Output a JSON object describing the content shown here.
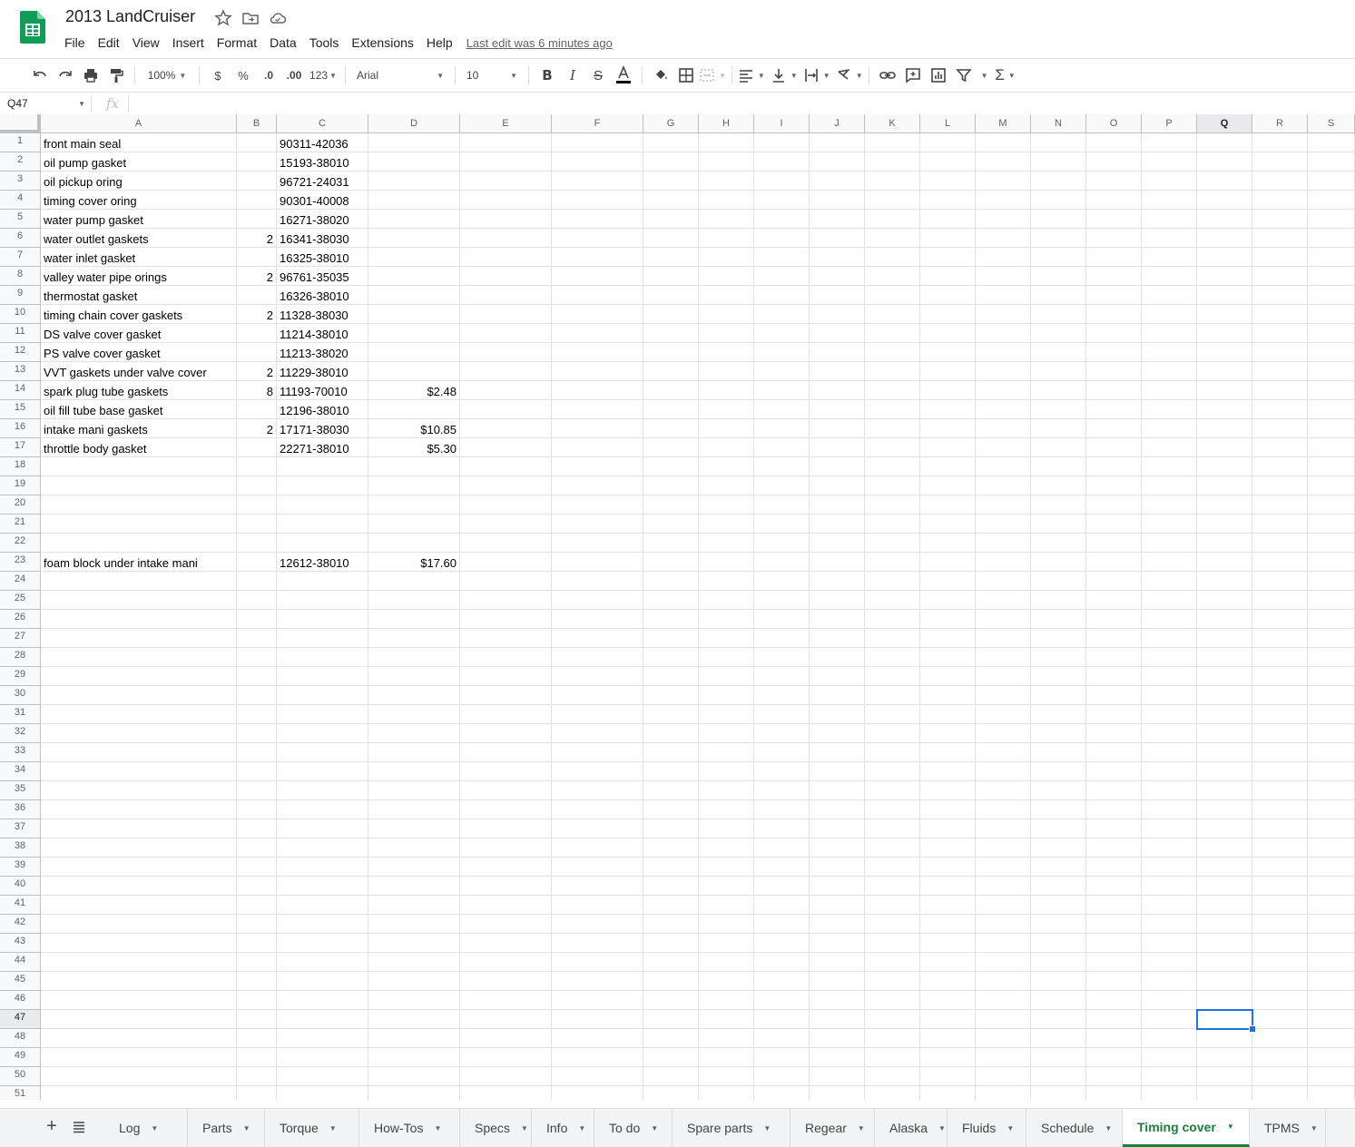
{
  "app": {
    "title": "2013 LandCruiser",
    "menus": [
      "File",
      "Edit",
      "View",
      "Insert",
      "Format",
      "Data",
      "Tools",
      "Extensions",
      "Help"
    ],
    "last_edit": "Last edit was 6 minutes ago"
  },
  "toolbar": {
    "zoom": "100%",
    "currency": "$",
    "percent": "%",
    "dec_decrease": ".0",
    "dec_increase": ".00",
    "more_formats": "123",
    "font": "Arial",
    "font_size": "10"
  },
  "formula_bar": {
    "name_box": "Q47",
    "fx": "fx",
    "value": ""
  },
  "columns": [
    "A",
    "B",
    "C",
    "D",
    "E",
    "F",
    "G",
    "H",
    "I",
    "J",
    "K",
    "L",
    "M",
    "N",
    "O",
    "P",
    "Q",
    "R",
    "S"
  ],
  "selected_cell": "Q47",
  "rows": [
    {
      "n": "1",
      "A": "front main seal",
      "B": "",
      "C": "90311-42036",
      "D": ""
    },
    {
      "n": "2",
      "A": "oil pump gasket",
      "B": "",
      "C": "15193-38010",
      "D": ""
    },
    {
      "n": "3",
      "A": "oil pickup oring",
      "B": "",
      "C": "96721-24031",
      "D": ""
    },
    {
      "n": "4",
      "A": "timing cover oring",
      "B": "",
      "C": "90301-40008",
      "D": ""
    },
    {
      "n": "5",
      "A": "water pump gasket",
      "B": "",
      "C": "16271-38020",
      "D": ""
    },
    {
      "n": "6",
      "A": "water outlet gaskets",
      "B": "2",
      "C": "16341-38030",
      "D": ""
    },
    {
      "n": "7",
      "A": "water inlet gasket",
      "B": "",
      "C": "16325-38010",
      "D": ""
    },
    {
      "n": "8",
      "A": "valley water pipe orings",
      "B": "2",
      "C": "96761-35035",
      "D": ""
    },
    {
      "n": "9",
      "A": "thermostat gasket",
      "B": "",
      "C": "16326-38010",
      "D": ""
    },
    {
      "n": "10",
      "A": "timing chain cover gaskets",
      "B": "2",
      "C": "11328-38030",
      "D": ""
    },
    {
      "n": "11",
      "A": "DS valve cover gasket",
      "B": "",
      "C": "11214-38010",
      "D": ""
    },
    {
      "n": "12",
      "A": "PS valve cover gasket",
      "B": "",
      "C": "11213-38020",
      "D": ""
    },
    {
      "n": "13",
      "A": "VVT gaskets under valve cover",
      "B": "2",
      "C": "11229-38010",
      "D": ""
    },
    {
      "n": "14",
      "A": "spark plug tube gaskets",
      "B": "8",
      "C": "11193-70010",
      "D": "$2.48"
    },
    {
      "n": "15",
      "A": "oil fill tube base gasket",
      "B": "",
      "C": "12196-38010",
      "D": ""
    },
    {
      "n": "16",
      "A": "intake mani gaskets",
      "B": "2",
      "C": "17171-38030",
      "D": "$10.85"
    },
    {
      "n": "17",
      "A": "throttle body gasket",
      "B": "",
      "C": "22271-38010",
      "D": "$5.30"
    },
    {
      "n": "18",
      "A": "",
      "B": "",
      "C": "",
      "D": ""
    },
    {
      "n": "19",
      "A": "",
      "B": "",
      "C": "",
      "D": ""
    },
    {
      "n": "20",
      "A": "",
      "B": "",
      "C": "",
      "D": ""
    },
    {
      "n": "21",
      "A": "",
      "B": "",
      "C": "",
      "D": ""
    },
    {
      "n": "22",
      "A": "",
      "B": "",
      "C": "",
      "D": ""
    },
    {
      "n": "23",
      "A": "foam block under intake mani",
      "B": "",
      "C": "12612-38010",
      "D": "$17.60"
    },
    {
      "n": "24",
      "A": "",
      "B": "",
      "C": "",
      "D": ""
    },
    {
      "n": "25",
      "A": "",
      "B": "",
      "C": "",
      "D": ""
    },
    {
      "n": "26",
      "A": "",
      "B": "",
      "C": "",
      "D": ""
    },
    {
      "n": "27",
      "A": "",
      "B": "",
      "C": "",
      "D": ""
    },
    {
      "n": "28",
      "A": "",
      "B": "",
      "C": "",
      "D": ""
    },
    {
      "n": "29",
      "A": "",
      "B": "",
      "C": "",
      "D": ""
    },
    {
      "n": "30",
      "A": "",
      "B": "",
      "C": "",
      "D": ""
    },
    {
      "n": "31",
      "A": "",
      "B": "",
      "C": "",
      "D": ""
    },
    {
      "n": "32",
      "A": "",
      "B": "",
      "C": "",
      "D": ""
    },
    {
      "n": "33",
      "A": "",
      "B": "",
      "C": "",
      "D": ""
    },
    {
      "n": "34",
      "A": "",
      "B": "",
      "C": "",
      "D": ""
    },
    {
      "n": "35",
      "A": "",
      "B": "",
      "C": "",
      "D": ""
    },
    {
      "n": "36",
      "A": "",
      "B": "",
      "C": "",
      "D": ""
    },
    {
      "n": "37",
      "A": "",
      "B": "",
      "C": "",
      "D": ""
    },
    {
      "n": "38",
      "A": "",
      "B": "",
      "C": "",
      "D": ""
    },
    {
      "n": "39",
      "A": "",
      "B": "",
      "C": "",
      "D": ""
    },
    {
      "n": "40",
      "A": "",
      "B": "",
      "C": "",
      "D": ""
    },
    {
      "n": "41",
      "A": "",
      "B": "",
      "C": "",
      "D": ""
    },
    {
      "n": "42",
      "A": "",
      "B": "",
      "C": "",
      "D": ""
    },
    {
      "n": "43",
      "A": "",
      "B": "",
      "C": "",
      "D": ""
    },
    {
      "n": "44",
      "A": "",
      "B": "",
      "C": "",
      "D": ""
    },
    {
      "n": "45",
      "A": "",
      "B": "",
      "C": "",
      "D": ""
    },
    {
      "n": "46",
      "A": "",
      "B": "",
      "C": "",
      "D": ""
    },
    {
      "n": "47",
      "A": "",
      "B": "",
      "C": "",
      "D": ""
    },
    {
      "n": "48",
      "A": "",
      "B": "",
      "C": "",
      "D": ""
    },
    {
      "n": "49",
      "A": "",
      "B": "",
      "C": "",
      "D": ""
    },
    {
      "n": "50",
      "A": "",
      "B": "",
      "C": "",
      "D": ""
    },
    {
      "n": "51",
      "A": "",
      "B": "",
      "C": "",
      "D": ""
    }
  ],
  "sheets": [
    "Log",
    "Parts",
    "Torque",
    "How-Tos",
    "Specs",
    "Info",
    "To do",
    "Spare parts",
    "Regear",
    "Alaska",
    "Fluids",
    "Schedule",
    "Timing cover",
    "TPMS"
  ],
  "active_sheet": "Timing cover",
  "colors": {
    "brand_green": "#188038",
    "selection_blue": "#1a73e8"
  }
}
